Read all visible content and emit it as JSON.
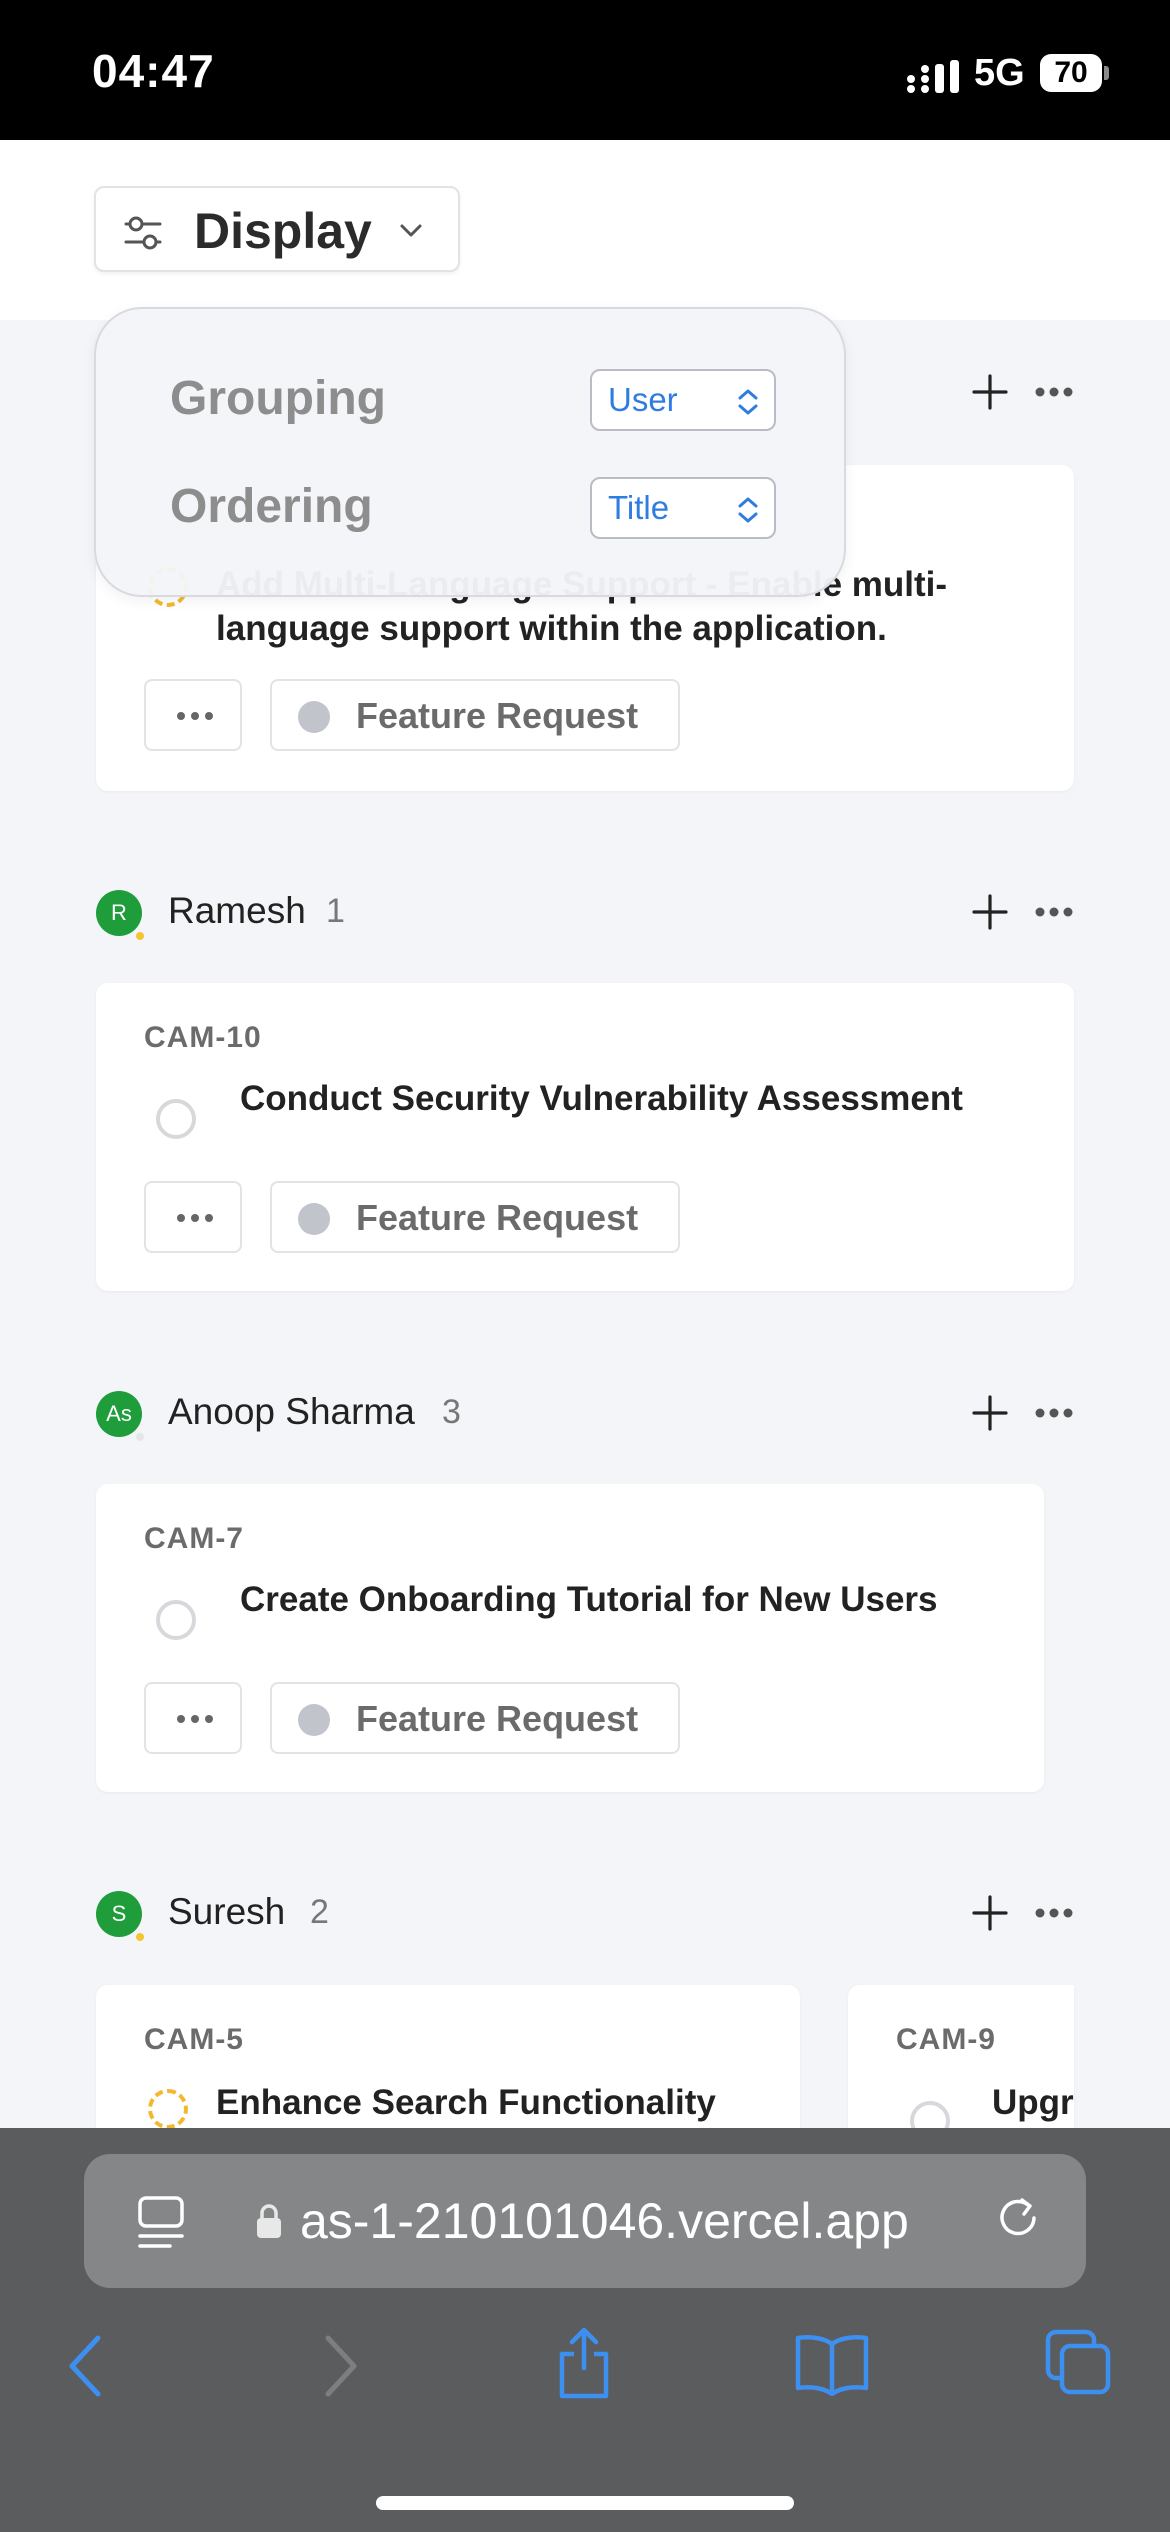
{
  "status_bar": {
    "time": "04:47",
    "network": "5G",
    "battery": "70"
  },
  "toolbar": {
    "display_label": "Display"
  },
  "popover": {
    "grouping_label": "Grouping",
    "grouping_value": "User",
    "ordering_label": "Ordering",
    "ordering_value": "Title"
  },
  "groups": [
    {
      "cards": [
        {
          "title_line1": "Add Multi-Language Support - Enable multi-",
          "title_line2": "language support within the application.",
          "tag": "Feature Request"
        }
      ]
    },
    {
      "avatar": "R",
      "name": "Ramesh",
      "count": "1",
      "cards": [
        {
          "id": "CAM-10",
          "title": "Conduct Security Vulnerability Assessment",
          "tag": "Feature Request"
        }
      ]
    },
    {
      "avatar": "As",
      "name": "Anoop Sharma",
      "count": "3",
      "cards": [
        {
          "id": "CAM-7",
          "title": "Create Onboarding Tutorial for New Users",
          "tag": "Feature Request"
        }
      ]
    },
    {
      "avatar": "S",
      "name": "Suresh",
      "count": "2",
      "cards": [
        {
          "id": "CAM-5",
          "title": "Enhance Search Functionality"
        },
        {
          "id": "CAM-9",
          "title": "Upgr"
        }
      ]
    }
  ],
  "browser": {
    "url": "as-1-210101046.vercel.app"
  },
  "colors": {
    "accent": "#2f7de0",
    "avatar": "#1f9d3a",
    "in_progress": "#f2b92e",
    "safari_blue": "#3d8ff0"
  }
}
